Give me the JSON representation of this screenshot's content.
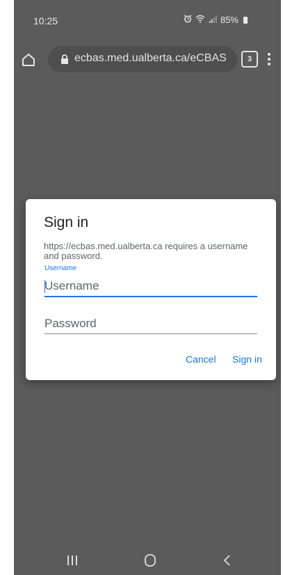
{
  "status_bar": {
    "time": "10:25",
    "battery_percent": "85%",
    "icons": [
      "alarm-icon",
      "wifi-icon",
      "signal-icon",
      "battery-icon"
    ]
  },
  "browser": {
    "url": "ecbas.med.ualberta.ca/eCBAS",
    "tab_count": "3",
    "icons": [
      "home-icon",
      "lock-icon",
      "tabs-icon",
      "more-vert-icon"
    ]
  },
  "dialog": {
    "title": "Sign in",
    "message": "https://ecbas.med.ualberta.ca requires a username and password.",
    "username_label": "Username",
    "username_placeholder": "Username",
    "username_value": "",
    "password_placeholder": "Password",
    "password_value": "",
    "cancel_label": "Cancel",
    "signin_label": "Sign in"
  },
  "nav": {
    "icons": [
      "recent-apps-icon",
      "home-icon",
      "back-icon"
    ]
  },
  "colors": {
    "accent": "#1a73e8",
    "overlay_background": "#5b5b5b",
    "dialog_background": "#ffffff"
  }
}
